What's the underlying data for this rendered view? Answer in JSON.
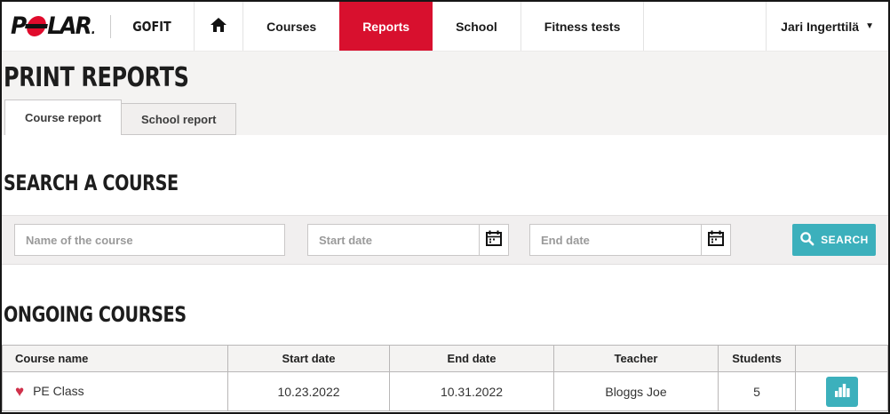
{
  "brand": {
    "logo_full": "POLAR",
    "logo_p": "P",
    "logo_lar": "LAR",
    "logo_dot": ".",
    "product": "GOFIT"
  },
  "nav": {
    "items": [
      {
        "label": "Courses"
      },
      {
        "label": "Reports"
      },
      {
        "label": "School"
      },
      {
        "label": "Fitness tests"
      }
    ],
    "user": "Jari Ingerttilä",
    "caret": "▼"
  },
  "page": {
    "title": "PRINT REPORTS",
    "tabs": [
      {
        "label": "Course report"
      },
      {
        "label": "School report"
      }
    ]
  },
  "search": {
    "heading": "SEARCH A COURSE",
    "name_placeholder": "Name of the course",
    "start_placeholder": "Start date",
    "end_placeholder": "End date",
    "button_label": "SEARCH"
  },
  "ongoing": {
    "heading": "ONGOING COURSES",
    "columns": [
      "Course name",
      "Start date",
      "End date",
      "Teacher",
      "Students",
      ""
    ],
    "rows": [
      {
        "course": "PE Class",
        "start": "10.23.2022",
        "end": "10.31.2022",
        "teacher": "Bloggs Joe",
        "students": "5"
      }
    ]
  },
  "icons": {
    "heart": "♥"
  },
  "colors": {
    "accent_teal": "#3cb0bc",
    "brand_red": "#d8102e",
    "heart_red": "#d0314b"
  }
}
